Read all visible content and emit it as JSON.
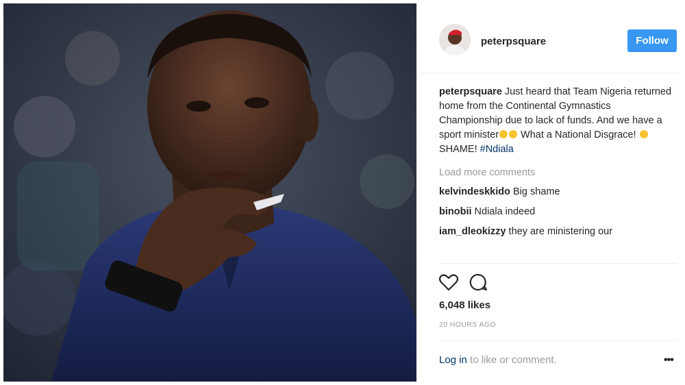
{
  "post": {
    "username": "peterpsquare",
    "follow_label": "Follow",
    "caption": {
      "user": "peterpsquare",
      "text_1": " Just heard that Team Nigeria returned home from the Continental Gymnastics Championship due to lack of funds. And we have a sport minister",
      "text_2": " What a National Disgrace! ",
      "text_3": "SHAME! ",
      "hashtag": "#Ndiala"
    },
    "load_more": "Load more comments",
    "comments": [
      {
        "user": "kelvindeskkido",
        "text": " Big shame"
      },
      {
        "user": "binobii",
        "text": " Ndiala indeed"
      },
      {
        "user": "iam_dleokizzy",
        "text": " they are ministering our"
      }
    ],
    "likes": "6,048 likes",
    "time": "20 HOURS AGO",
    "login": {
      "link": "Log in",
      "text": " to like or comment."
    },
    "more": "•••",
    "icons": {
      "like": "heart-icon",
      "comment": "comment-bubble-icon"
    },
    "colors": {
      "follow": "#3897f0",
      "link": "#003569",
      "muted": "#999999"
    }
  }
}
